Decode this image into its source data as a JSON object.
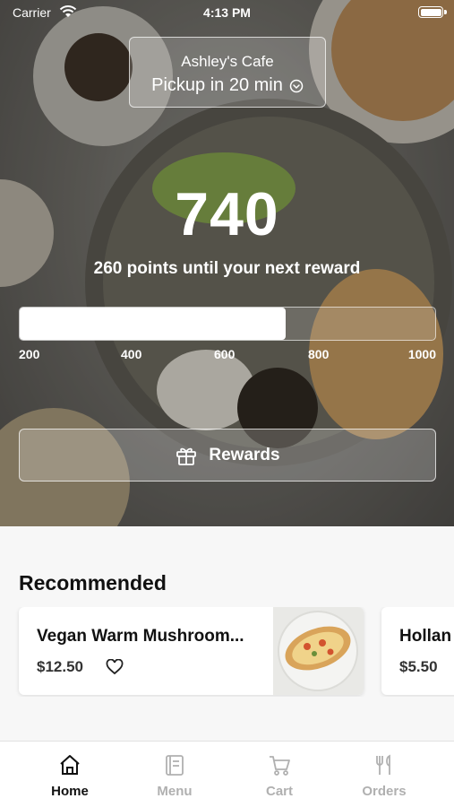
{
  "status_bar": {
    "carrier": "Carrier",
    "time": "4:13 PM"
  },
  "store": {
    "name": "Ashley's Cafe",
    "pickup": "Pickup in 20 min"
  },
  "rewards": {
    "points": "740",
    "caption": "260 points until your next reward",
    "progress_fraction": 0.64,
    "scale_labels": [
      "200",
      "400",
      "600",
      "800",
      "1000"
    ],
    "button_label": "Rewards"
  },
  "recommended": {
    "title": "Recommended",
    "items": [
      {
        "name": "Vegan Warm Mushroom...",
        "price": "$12.50"
      },
      {
        "name": "Hollan",
        "price": "$5.50"
      }
    ]
  },
  "tabs": [
    {
      "label": "Home",
      "icon": "home-icon",
      "active": true
    },
    {
      "label": "Menu",
      "icon": "menu-icon",
      "active": false
    },
    {
      "label": "Cart",
      "icon": "cart-icon",
      "active": false
    },
    {
      "label": "Orders",
      "icon": "orders-icon",
      "active": false
    }
  ]
}
